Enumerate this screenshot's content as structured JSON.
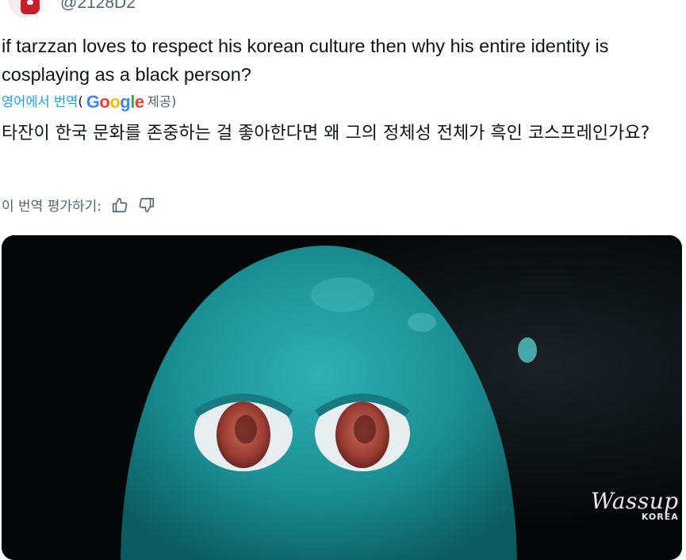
{
  "tweet": {
    "handle": "@2128D2",
    "text_en": "if tarzzan loves to respect his korean culture then why his entire identity is cosplaying as a black person?",
    "translation": {
      "link_label": "영어에서 번역",
      "paren_open": "(",
      "provider_logo": "Google",
      "provider_suffix": "제공)",
      "text_ko": "타잔이 한국 문화를 존중하는 걸 좋아한다면 왜 그의 정체성 전체가 흑인 코스프레인가요?",
      "rate_label": "이 번역 평가하기:",
      "thumbs_up_icon": "thumbs-up-icon",
      "thumbs_down_icon": "thumbs-down-icon"
    },
    "media": {
      "watermark_brand": "Wassup",
      "watermark_sub": "KOREA"
    }
  },
  "colors": {
    "link": "#1d9bf0",
    "secondary": "#536471",
    "google_blue": "#4285F4",
    "google_red": "#EA4335",
    "google_yellow": "#FBBC05",
    "google_green": "#34A853",
    "creature_teal": "#1c8e93"
  }
}
